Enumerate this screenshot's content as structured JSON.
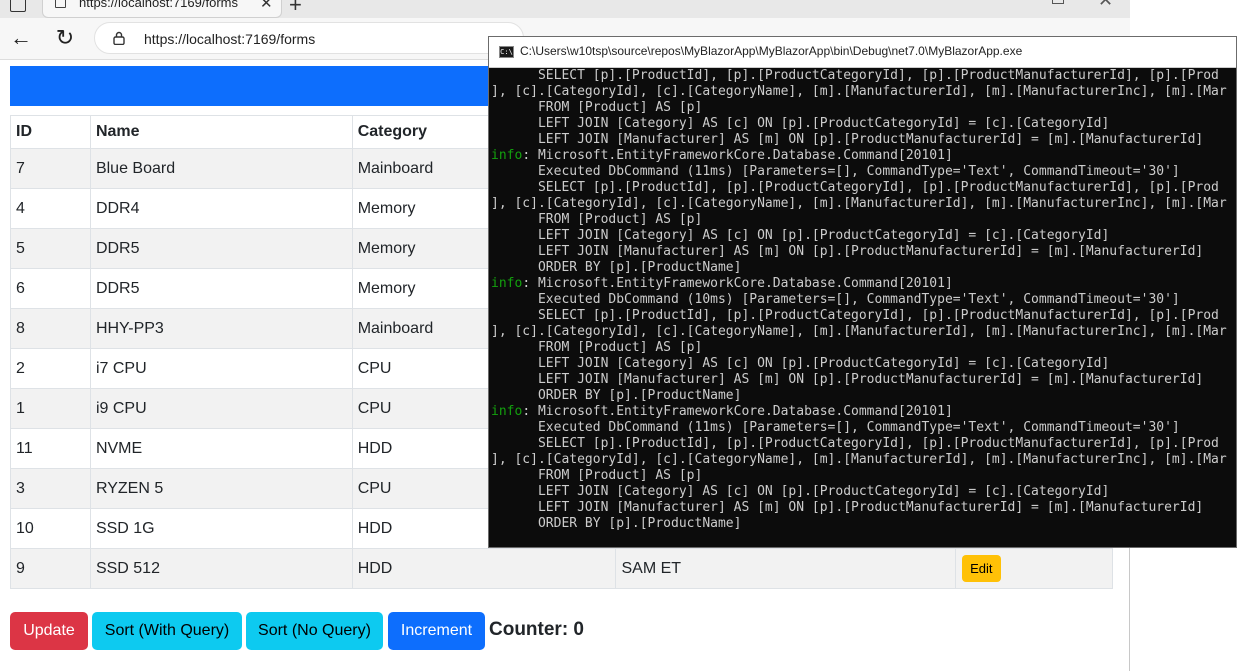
{
  "browser": {
    "tab_title": "https://localhost:7169/forms",
    "tab_close": "✕",
    "new_tab": "+",
    "url": "https://localhost:7169/forms",
    "back_glyph": "←",
    "reload_glyph": "↻"
  },
  "table": {
    "headers": [
      "ID",
      "Name",
      "Category",
      "",
      ""
    ],
    "rows": [
      {
        "id": "7",
        "name": "Blue Board",
        "category": "Mainboard",
        "manufacturer": ""
      },
      {
        "id": "4",
        "name": "DDR4",
        "category": "Memory",
        "manufacturer": ""
      },
      {
        "id": "5",
        "name": "DDR5",
        "category": "Memory",
        "manufacturer": ""
      },
      {
        "id": "6",
        "name": "DDR5",
        "category": "Memory",
        "manufacturer": ""
      },
      {
        "id": "8",
        "name": "HHY-PP3",
        "category": "Mainboard",
        "manufacturer": ""
      },
      {
        "id": "2",
        "name": "i7 CPU",
        "category": "CPU",
        "manufacturer": ""
      },
      {
        "id": "1",
        "name": "i9 CPU",
        "category": "CPU",
        "manufacturer": ""
      },
      {
        "id": "11",
        "name": "NVME",
        "category": "HDD",
        "manufacturer": ""
      },
      {
        "id": "3",
        "name": "RYZEN 5",
        "category": "CPU",
        "manufacturer": ""
      },
      {
        "id": "10",
        "name": "SSD 1G",
        "category": "HDD",
        "manufacturer": ""
      },
      {
        "id": "9",
        "name": "SSD 512",
        "category": "HDD",
        "manufacturer": "SAM ET",
        "edit": "Edit"
      }
    ]
  },
  "buttons": {
    "update": "Update",
    "sort_query": "Sort (With Query)",
    "sort_noquery": "Sort (No Query)",
    "increment": "Increment"
  },
  "counter": {
    "label": "Counter: 0"
  },
  "console": {
    "title": "C:\\Users\\w10tsp\\source\\repos\\MyBlazorApp\\MyBlazorApp\\bin\\Debug\\net7.0\\MyBlazorApp.exe",
    "icon_text": "C:\\",
    "lines": [
      {
        "prefix": "",
        "text": "      SELECT [p].[ProductId], [p].[ProductCategoryId], [p].[ProductManufacturerId], [p].[Prod"
      },
      {
        "prefix": "",
        "text": "], [c].[CategoryId], [c].[CategoryName], [m].[ManufacturerId], [m].[ManufacturerInc], [m].[Mar"
      },
      {
        "prefix": "",
        "text": "      FROM [Product] AS [p]"
      },
      {
        "prefix": "",
        "text": "      LEFT JOIN [Category] AS [c] ON [p].[ProductCategoryId] = [c].[CategoryId]"
      },
      {
        "prefix": "",
        "text": "      LEFT JOIN [Manufacturer] AS [m] ON [p].[ProductManufacturerId] = [m].[ManufacturerId]"
      },
      {
        "prefix": "info",
        "text": ": Microsoft.EntityFrameworkCore.Database.Command[20101]"
      },
      {
        "prefix": "",
        "text": "      Executed DbCommand (11ms) [Parameters=[], CommandType='Text', CommandTimeout='30']"
      },
      {
        "prefix": "",
        "text": "      SELECT [p].[ProductId], [p].[ProductCategoryId], [p].[ProductManufacturerId], [p].[Prod"
      },
      {
        "prefix": "",
        "text": "], [c].[CategoryId], [c].[CategoryName], [m].[ManufacturerId], [m].[ManufacturerInc], [m].[Mar"
      },
      {
        "prefix": "",
        "text": "      FROM [Product] AS [p]"
      },
      {
        "prefix": "",
        "text": "      LEFT JOIN [Category] AS [c] ON [p].[ProductCategoryId] = [c].[CategoryId]"
      },
      {
        "prefix": "",
        "text": "      LEFT JOIN [Manufacturer] AS [m] ON [p].[ProductManufacturerId] = [m].[ManufacturerId]"
      },
      {
        "prefix": "",
        "text": "      ORDER BY [p].[ProductName]"
      },
      {
        "prefix": "info",
        "text": ": Microsoft.EntityFrameworkCore.Database.Command[20101]"
      },
      {
        "prefix": "",
        "text": "      Executed DbCommand (10ms) [Parameters=[], CommandType='Text', CommandTimeout='30']"
      },
      {
        "prefix": "",
        "text": "      SELECT [p].[ProductId], [p].[ProductCategoryId], [p].[ProductManufacturerId], [p].[Prod"
      },
      {
        "prefix": "",
        "text": "], [c].[CategoryId], [c].[CategoryName], [m].[ManufacturerId], [m].[ManufacturerInc], [m].[Mar"
      },
      {
        "prefix": "",
        "text": "      FROM [Product] AS [p]"
      },
      {
        "prefix": "",
        "text": "      LEFT JOIN [Category] AS [c] ON [p].[ProductCategoryId] = [c].[CategoryId]"
      },
      {
        "prefix": "",
        "text": "      LEFT JOIN [Manufacturer] AS [m] ON [p].[ProductManufacturerId] = [m].[ManufacturerId]"
      },
      {
        "prefix": "",
        "text": "      ORDER BY [p].[ProductName]"
      },
      {
        "prefix": "info",
        "text": ": Microsoft.EntityFrameworkCore.Database.Command[20101]"
      },
      {
        "prefix": "",
        "text": "      Executed DbCommand (11ms) [Parameters=[], CommandType='Text', CommandTimeout='30']"
      },
      {
        "prefix": "",
        "text": "      SELECT [p].[ProductId], [p].[ProductCategoryId], [p].[ProductManufacturerId], [p].[Prod"
      },
      {
        "prefix": "",
        "text": "], [c].[CategoryId], [c].[CategoryName], [m].[ManufacturerId], [m].[ManufacturerInc], [m].[Mar"
      },
      {
        "prefix": "",
        "text": "      FROM [Product] AS [p]"
      },
      {
        "prefix": "",
        "text": "      LEFT JOIN [Category] AS [c] ON [p].[ProductCategoryId] = [c].[CategoryId]"
      },
      {
        "prefix": "",
        "text": "      LEFT JOIN [Manufacturer] AS [m] ON [p].[ProductManufacturerId] = [m].[ManufacturerId]"
      },
      {
        "prefix": "",
        "text": "      ORDER BY [p].[ProductName]"
      }
    ]
  },
  "colors": {
    "primary": "#0d6efd",
    "danger": "#dc3545",
    "info": "#0dcaf0",
    "warning": "#ffc107",
    "console_bg": "#0c0c0c",
    "console_info": "#13a10e"
  }
}
